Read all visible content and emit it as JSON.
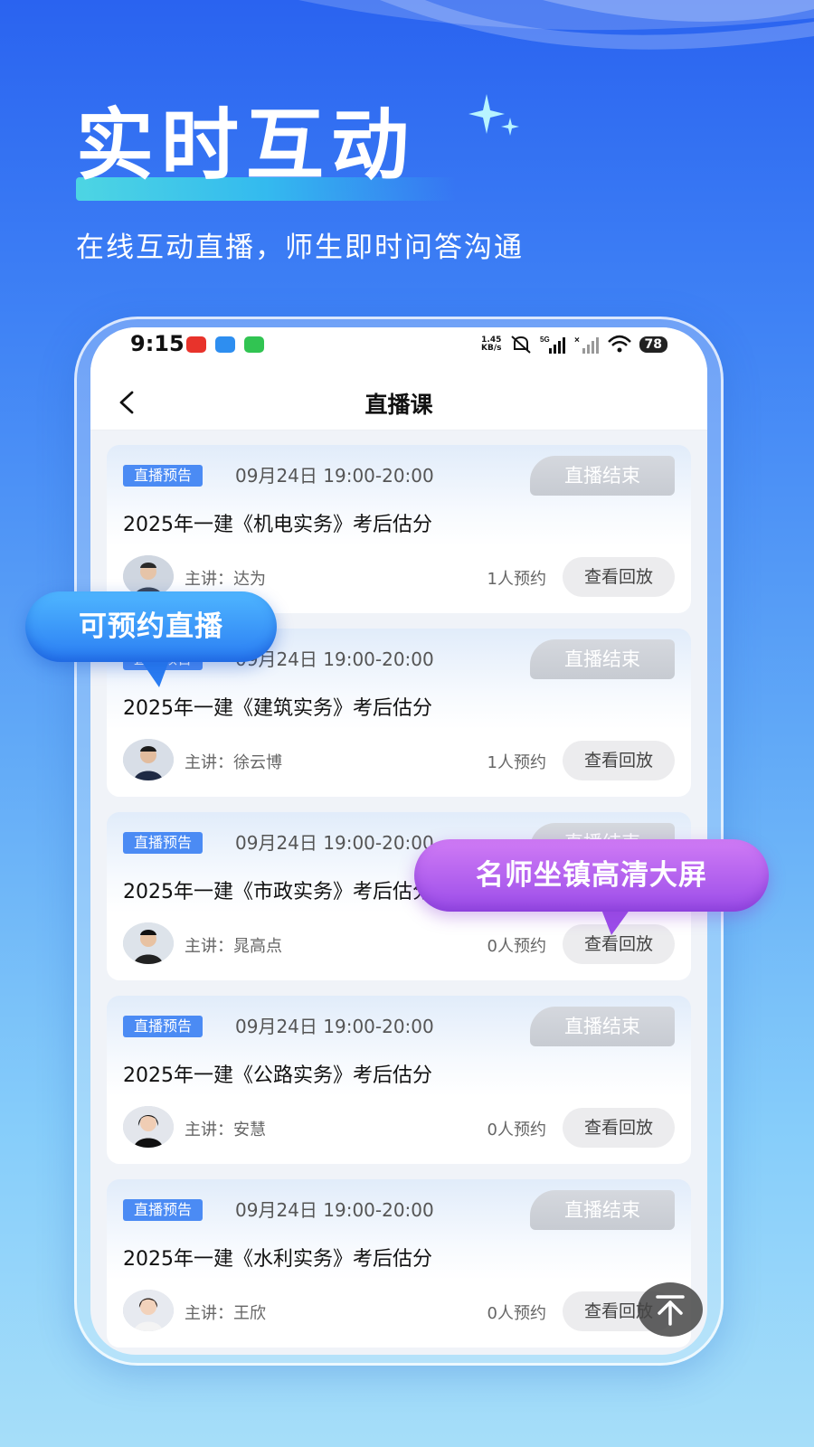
{
  "hero": {
    "title": "实时互动",
    "subtitle": "在线互动直播，师生即时问答沟通"
  },
  "status_bar": {
    "time": "9:15",
    "net_speed_value": "1.45",
    "net_speed_unit": "KB/s",
    "network": "5G",
    "battery": "78",
    "icons": [
      "toutiao-app-icon",
      "cloud-app-icon",
      "wechat-app-icon",
      "mute-icon",
      "signal-icon",
      "signal-off-icon",
      "wifi-icon",
      "battery-icon"
    ]
  },
  "nav": {
    "back_icon": "back-arrow-icon",
    "title": "直播课"
  },
  "courses": [
    {
      "tag": "直播预告",
      "time": "09月24日 19:00-20:00",
      "status": "直播结束",
      "title": "2025年一建《机电实务》考后估分",
      "lecturer": "主讲：达为",
      "reservations": "1人预约",
      "action": "查看回放"
    },
    {
      "tag": "直播预告",
      "time": "09月24日 19:00-20:00",
      "status": "直播结束",
      "title": "2025年一建《建筑实务》考后估分",
      "lecturer": "主讲：徐云博",
      "reservations": "1人预约",
      "action": "查看回放"
    },
    {
      "tag": "直播预告",
      "time": "09月24日 19:00-20:00",
      "status": "直播结束",
      "title": "2025年一建《市政实务》考后估分",
      "lecturer": "主讲：晁高点",
      "reservations": "0人预约",
      "action": "查看回放"
    },
    {
      "tag": "直播预告",
      "time": "09月24日 19:00-20:00",
      "status": "直播结束",
      "title": "2025年一建《公路实务》考后估分",
      "lecturer": "主讲：安慧",
      "reservations": "0人预约",
      "action": "查看回放"
    },
    {
      "tag": "直播预告",
      "time": "09月24日 19:00-20:00",
      "status": "直播结束",
      "title": "2025年一建《水利实务》考后估分",
      "lecturer": "主讲：王欣",
      "reservations": "0人预约",
      "action": "查看回放"
    }
  ],
  "callouts": {
    "left": "可预约直播",
    "right": "名师坐镇高清大屏"
  },
  "colors": {
    "accent_blue": "#4b8bf4",
    "bubble_purple": "#9b4de9",
    "status_gray": "#c7cbd2"
  }
}
